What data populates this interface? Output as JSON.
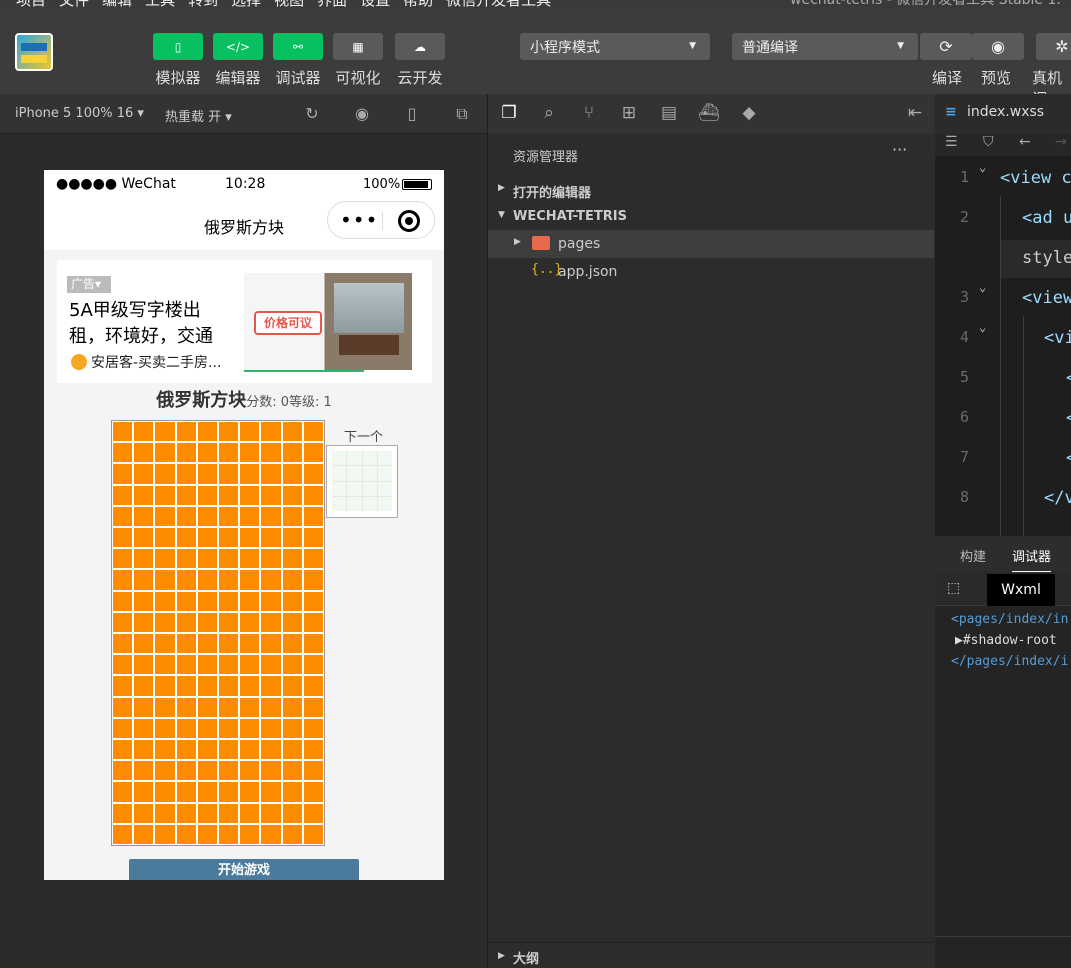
{
  "menubar": {
    "items": [
      "项目",
      "文件",
      "编辑",
      "工具",
      "转到",
      "选择",
      "视图",
      "界面",
      "设置",
      "帮助",
      "微信开发者工具"
    ],
    "window_title": "wechat-tetris - 微信开发者工具 Stable 1."
  },
  "toolbar": {
    "buttons": [
      {
        "label": "模拟器",
        "icon": "phone-icon"
      },
      {
        "label": "编辑器",
        "icon": "code-icon"
      },
      {
        "label": "调试器",
        "icon": "debug-icon"
      },
      {
        "label": "可视化",
        "icon": "layout-icon"
      },
      {
        "label": "云开发",
        "icon": "cloud-icon"
      }
    ],
    "mode_select": "小程序模式",
    "compile_select": "普通编译",
    "right_buttons": [
      {
        "label": "编译",
        "icon": "refresh-icon"
      },
      {
        "label": "预览",
        "icon": "eye-icon"
      },
      {
        "label": "真机调",
        "icon": "bug-icon"
      }
    ],
    "accent": "#07c160"
  },
  "simulator": {
    "device": "iPhone 5 100% 16 ▾",
    "hot_reload": "热重载 开 ▾"
  },
  "phone": {
    "carrier": "●●●●● WeChat",
    "time": "10:28",
    "battery": "100%",
    "nav_title": "俄罗斯方块",
    "capsule_dots": "•••",
    "ad": {
      "badge": "广告",
      "text": "5A甲级写字楼出租，环境好，交通",
      "source": "安居客-买卖二手房...",
      "tag": "价格可议"
    },
    "game": {
      "title": "俄罗斯方块",
      "stats": "分数: 0等级: 1",
      "next_label": "下一个",
      "start_button": "开始游戏",
      "board_cols": 10,
      "board_rows": 20,
      "cell_color": "#ff8c00"
    }
  },
  "explorer": {
    "header": "资源管理器",
    "more": "···",
    "open_editors": "打开的编辑器",
    "project": "WECHAT-TETRIS",
    "items": [
      {
        "name": "pages",
        "type": "folder"
      },
      {
        "name": "app.json",
        "type": "json"
      }
    ],
    "json_icon": "{..}",
    "outline": "大纲"
  },
  "editor": {
    "tab": "index.wxss",
    "css_icon": "≡",
    "line_numbers": [
      "1",
      "2",
      "",
      "3",
      "4",
      "5",
      "6",
      "7",
      "8"
    ],
    "lines": [
      "<view c",
      "<ad u",
      "style",
      "<view",
      "<vi",
      "<",
      "<",
      "<",
      "</v"
    ]
  },
  "devtools": {
    "tabs": [
      "构建",
      "调试器"
    ],
    "active_tab": "调试器",
    "subtab": "Wxml",
    "dom": [
      "<pages/index/in",
      "▶#shadow-root",
      "</pages/index/i"
    ]
  }
}
